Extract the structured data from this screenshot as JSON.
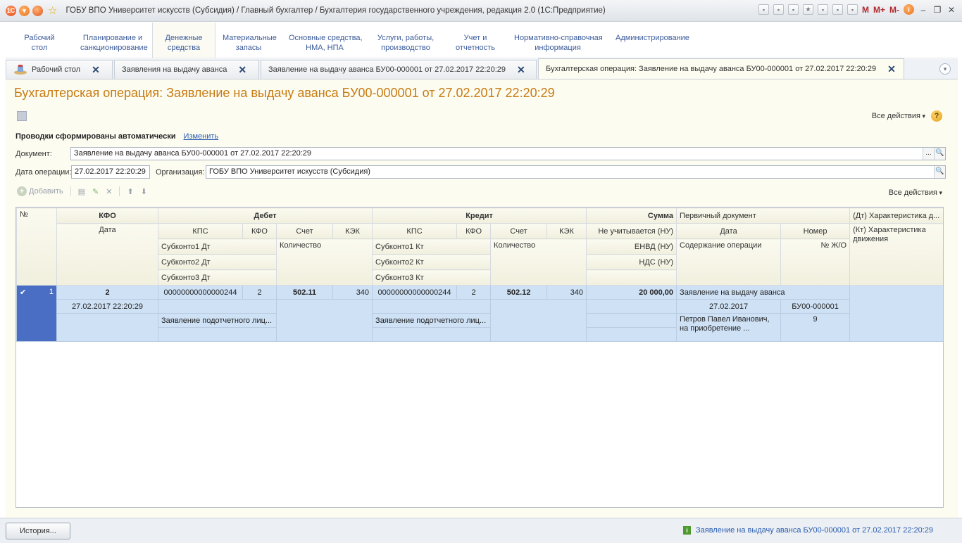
{
  "window": {
    "title": "ГОБУ ВПО Университет искусств (Субсидия) / Главный бухгалтер / Бухгалтерия государственного учреждения, редакция 2.0  (1С:Предприятие)",
    "m_buttons": [
      "M",
      "M+",
      "M-"
    ]
  },
  "sections": [
    {
      "label": "Рабочий\nстол"
    },
    {
      "label": "Планирование и\nсанкционирование"
    },
    {
      "label": "Денежные\nсредства"
    },
    {
      "label": "Материальные\nзапасы"
    },
    {
      "label": "Основные средства,\nНМА, НПА"
    },
    {
      "label": "Услуги, работы,\nпроизводство"
    },
    {
      "label": "Учет и\nотчетность"
    },
    {
      "label": "Нормативно-справочная\nинформация"
    },
    {
      "label": "Администрирование"
    }
  ],
  "tabs": [
    {
      "label": "Рабочий стол"
    },
    {
      "label": "Заявления на выдачу аванса"
    },
    {
      "label": "Заявление на выдачу аванса БУ00-000001 от 27.02.2017 22:20:29"
    },
    {
      "label": "Бухгалтерская операция: Заявление на выдачу аванса БУ00-000001 от 27.02.2017 22:20:29"
    }
  ],
  "form": {
    "title": "Бухгалтерская операция: Заявление на выдачу аванса БУ00-000001 от 27.02.2017 22:20:29",
    "all_actions": "Все действия",
    "auto_text": "Проводки сформированы автоматически",
    "change_link": "Изменить",
    "document_label": "Документ:",
    "document_value": "Заявление на выдачу аванса БУ00-000001 от 27.02.2017 22:20:29",
    "date_label": "Дата операции:",
    "date_value": "27.02.2017 22:20:29",
    "org_label": "Организация:",
    "org_value": "ГОБУ ВПО Университет искусств (Субсидия)",
    "add_button": "Добавить"
  },
  "table": {
    "h": {
      "num": "№",
      "kfo": "КФО",
      "date": "Дата",
      "debit": "Дебет",
      "credit": "Кредит",
      "sum": "Сумма",
      "primary_doc": "Первичный документ",
      "dt_char": "(Дт) Характеристика д...",
      "kt_char": "(Кт) Характеристика движения",
      "kps": "КПС",
      "kfo_small": "КФО",
      "account": "Счет",
      "kek": "КЭК",
      "not_counted": "Не учитывается (НУ)",
      "pd_date": "Дата",
      "pd_number": "Номер",
      "subkonto1_dt": "Субконто1 Дт",
      "subkonto2_dt": "Субконто2 Дт",
      "subkonto3_dt": "Субконто3 Дт",
      "subkonto1_kt": "Субконто1 Кт",
      "subkonto2_kt": "Субконто2 Кт",
      "subkonto3_kt": "Субконто3 Кт",
      "quantity": "Количество",
      "envd": "ЕНВД (НУ)",
      "nds": "НДС (НУ)",
      "content": "Содержание операции",
      "journal_num": "№ Ж/О"
    },
    "row": {
      "check": "✔",
      "num": "1",
      "kfo": "2",
      "date": "27.02.2017 22:20:29",
      "dt_kps": "00000000000000244",
      "dt_kfo": "2",
      "dt_account": "502.11",
      "dt_kek": "340",
      "dt_subkonto1": "Заявление подотчетного лиц...",
      "kt_kps": "00000000000000244",
      "kt_kfo": "2",
      "kt_account": "502.12",
      "kt_kek": "340",
      "kt_subkonto1": "Заявление подотчетного лиц...",
      "sum": "20 000,00",
      "pd_name": "Заявление на выдачу аванса",
      "pd_date": "27.02.2017",
      "pd_number": "БУ00-000001",
      "content_line1": "Петров Павел Иванович,",
      "content_line2": "на приобретение ...",
      "journal_num": "9"
    }
  },
  "bottom": {
    "history_button": "История...",
    "status_text": "Заявление на выдачу аванса БУ00-000001 от 27.02.2017 22:20:29"
  }
}
